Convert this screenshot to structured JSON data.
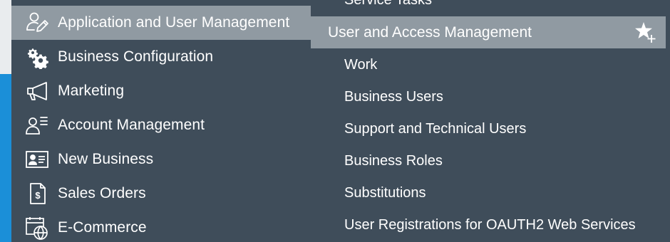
{
  "left_menu": {
    "items": [
      {
        "label": "Application and User Management",
        "icon": "user-edit-icon",
        "selected": true
      },
      {
        "label": "Business Configuration",
        "icon": "gears-icon",
        "selected": false
      },
      {
        "label": "Marketing",
        "icon": "megaphone-icon",
        "selected": false
      },
      {
        "label": "Account Management",
        "icon": "account-list-icon",
        "selected": false
      },
      {
        "label": "New Business",
        "icon": "id-card-icon",
        "selected": false
      },
      {
        "label": "Sales Orders",
        "icon": "dollar-document-icon",
        "selected": false
      },
      {
        "label": "E-Commerce",
        "icon": "globe-calendar-icon",
        "selected": false
      }
    ]
  },
  "sub_menu": {
    "top_cut_label": "Service Tasks",
    "header": {
      "label": "User and Access Management",
      "icon": "add-favorite-icon"
    },
    "items": [
      {
        "label": "Work"
      },
      {
        "label": "Business Users"
      },
      {
        "label": "Support and Technical Users"
      },
      {
        "label": "Business Roles"
      },
      {
        "label": "Substitutions"
      },
      {
        "label": "User Registrations for OAUTH2 Web Services"
      }
    ]
  },
  "colors": {
    "background": "#3f4d5a",
    "selected_bg": "#909aa2",
    "edge_accent": "#1b8fd8",
    "text": "#ffffff"
  }
}
